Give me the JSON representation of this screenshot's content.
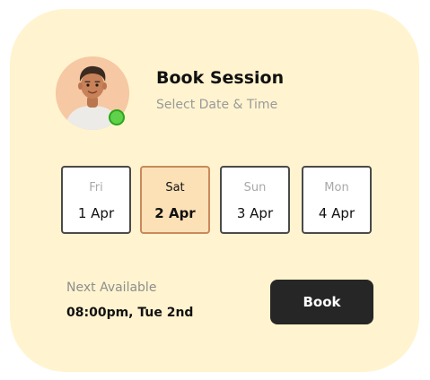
{
  "header": {
    "title": "Book Session",
    "subtitle": "Select Date & Time"
  },
  "avatar": {
    "status": "online",
    "status_color": "#5fd14b"
  },
  "days": [
    {
      "dow": "Fri",
      "date": "1 Apr",
      "selected": false
    },
    {
      "dow": "Sat",
      "date": "2 Apr",
      "selected": true
    },
    {
      "dow": "Sun",
      "date": "3 Apr",
      "selected": false
    },
    {
      "dow": "Mon",
      "date": "4 Apr",
      "selected": false
    }
  ],
  "next_available": {
    "label": "Next Available",
    "value": "08:00pm, Tue 2nd"
  },
  "actions": {
    "book_label": "Book"
  },
  "colors": {
    "card_background": "#fff4cf",
    "selected_day_background": "#fde1b6",
    "button_background": "#262626"
  }
}
